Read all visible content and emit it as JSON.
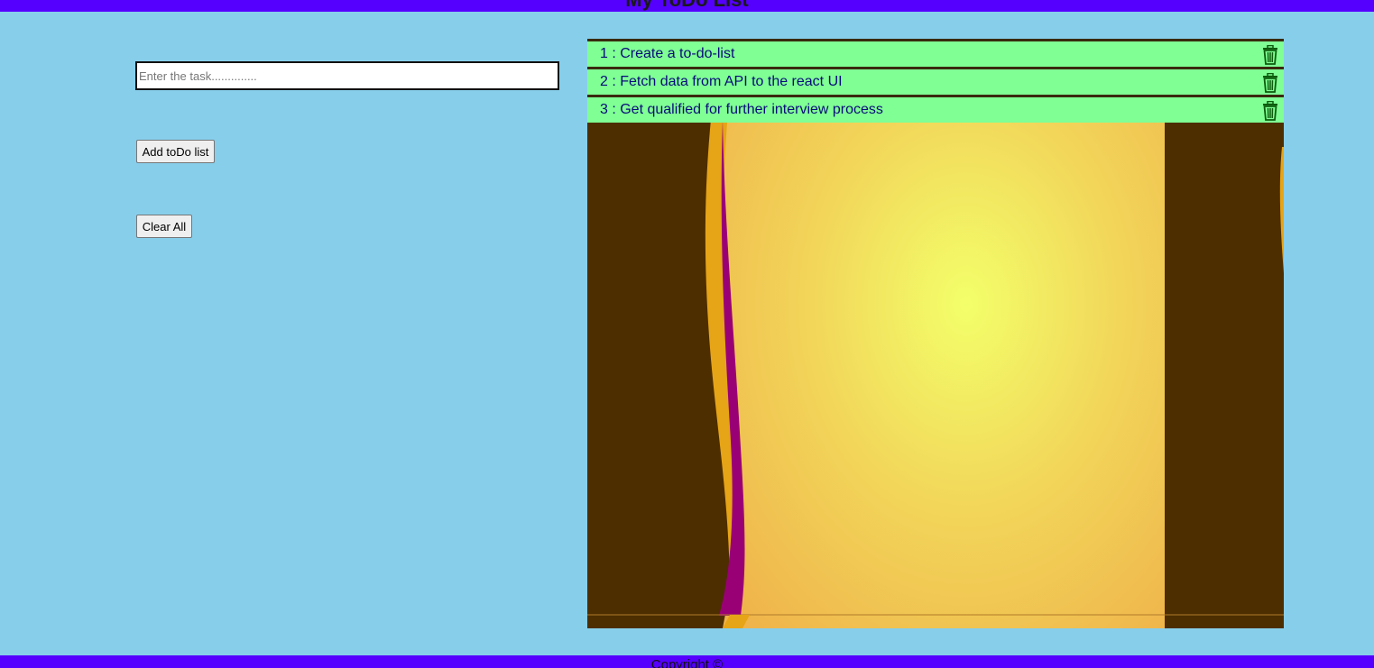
{
  "header": {
    "title": "My ToDo List"
  },
  "form": {
    "input_placeholder": "Enter the task..............",
    "input_value": "",
    "add_label": "Add toDo list",
    "clear_label": "Clear All"
  },
  "todos": [
    {
      "index": "1",
      "text": "Create a to-do-list",
      "display": "1 : Create a to-do-list",
      "icon": "trash-icon"
    },
    {
      "index": "2",
      "text": "Fetch data from API to the react UI",
      "display": "2 : Fetch data from API to the react UI",
      "icon": "trash-icon"
    },
    {
      "index": "3",
      "text": "Get qualified for further interview process",
      "display": "3 : Get qualified for further interview process",
      "icon": "trash-icon"
    }
  ],
  "footer": {
    "text": "Copyright ©"
  },
  "colors": {
    "bar": "#5500ff",
    "page_bg": "#87ceeb",
    "item_bg": "#7fff94",
    "item_text": "#0a0a7a",
    "trash": "#0d5c0d"
  }
}
